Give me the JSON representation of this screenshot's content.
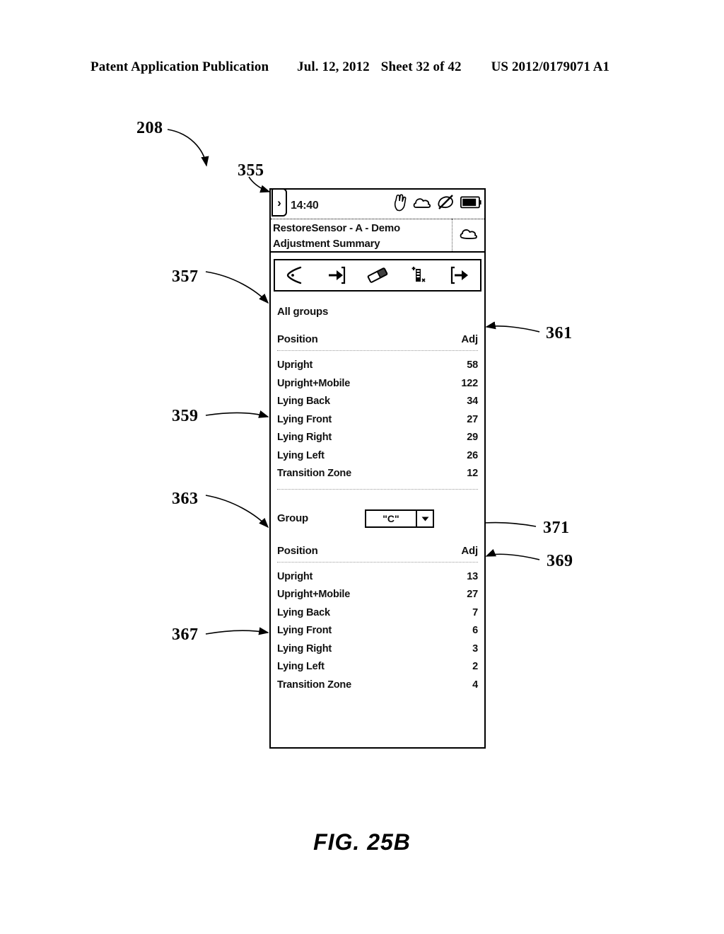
{
  "patent_header": {
    "publication": "Patent Application Publication",
    "date": "Jul. 12, 2012",
    "sheet": "Sheet 32 of 42",
    "number": "US 2012/0179071 A1"
  },
  "figure": {
    "caption": "FIG. 25B"
  },
  "device": {
    "status_bar": {
      "back_label": "›",
      "time": "14:40",
      "icons": [
        "hand-gesture-icon",
        "cloud-icon",
        "mute-slash-icon",
        "battery-icon"
      ]
    },
    "title_bar": {
      "line1": "RestoreSensor - A - Demo",
      "line2": "Adjustment Summary",
      "icon": "cloud-outline-icon"
    },
    "toolbar": {
      "buttons": [
        {
          "name": "back-chevron-icon",
          "label": ""
        },
        {
          "name": "arrow-into-box-icon",
          "label": ""
        },
        {
          "name": "eraser-icon",
          "label": ""
        },
        {
          "name": "lead-adjust-icon",
          "label": ""
        },
        {
          "name": "arrow-out-of-box-icon",
          "label": ""
        }
      ]
    },
    "all_groups": {
      "title": "All groups",
      "columns": {
        "position": "Position",
        "adj": "Adj"
      },
      "rows": [
        {
          "position": "Upright",
          "adj": "58"
        },
        {
          "position": "Upright+Mobile",
          "adj": "122"
        },
        {
          "position": "Lying Back",
          "adj": "34"
        },
        {
          "position": "Lying Front",
          "adj": "27"
        },
        {
          "position": "Lying Right",
          "adj": "29"
        },
        {
          "position": "Lying Left",
          "adj": "26"
        },
        {
          "position": "Transition Zone",
          "adj": "12"
        }
      ]
    },
    "group_section": {
      "label": "Group",
      "selected": "\"C\"",
      "dropdown_arrow": "▼",
      "columns": {
        "position": "Position",
        "adj": "Adj"
      },
      "rows": [
        {
          "position": "Upright",
          "adj": "13"
        },
        {
          "position": "Upright+Mobile",
          "adj": "27"
        },
        {
          "position": "Lying Back",
          "adj": "7"
        },
        {
          "position": "Lying Front",
          "adj": "6"
        },
        {
          "position": "Lying Right",
          "adj": "3"
        },
        {
          "position": "Lying Left",
          "adj": "2"
        },
        {
          "position": "Transition Zone",
          "adj": "4"
        }
      ]
    }
  },
  "reference_numerals": [
    {
      "id": "208",
      "label": "208"
    },
    {
      "id": "355",
      "label": "355"
    },
    {
      "id": "357",
      "label": "357"
    },
    {
      "id": "359",
      "label": "359"
    },
    {
      "id": "361",
      "label": "361"
    },
    {
      "id": "363",
      "label": "363"
    },
    {
      "id": "367",
      "label": "367"
    },
    {
      "id": "369",
      "label": "369"
    },
    {
      "id": "371",
      "label": "371"
    }
  ]
}
